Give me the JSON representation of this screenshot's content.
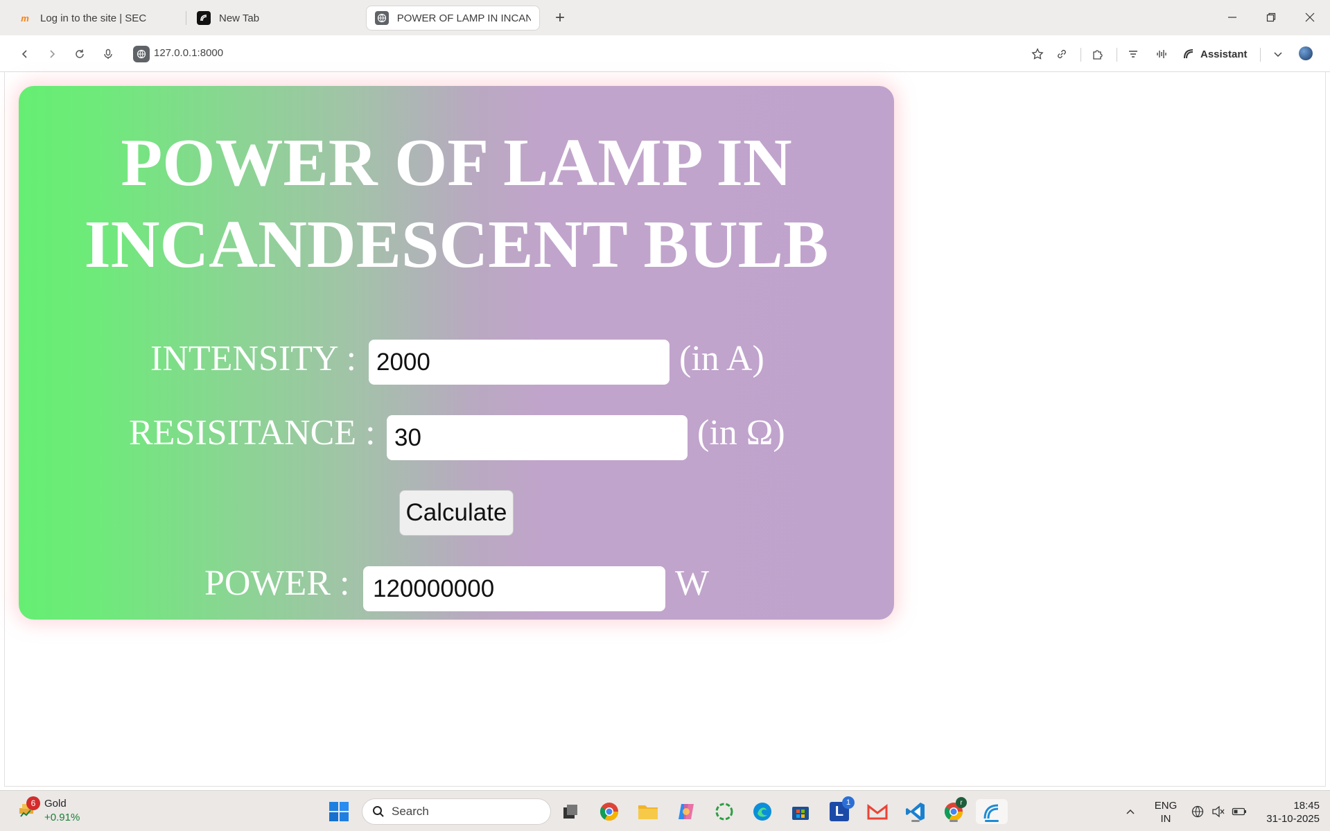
{
  "browser": {
    "tabs": [
      {
        "label": "Log in to the site | SEC",
        "icon": "moodle-icon"
      },
      {
        "label": "New Tab",
        "icon": "browser-logo-icon"
      },
      {
        "label": "POWER OF LAMP IN INCAND",
        "icon": "globe-icon",
        "active": true
      }
    ],
    "url": "127.0.0.1:8000",
    "assistant_label": "Assistant"
  },
  "page": {
    "title": "POWER OF LAMP IN INCANDESCENT BULB",
    "intensity": {
      "label": "INTENSITY :",
      "value": "2000",
      "unit": "(in A)"
    },
    "resistance": {
      "label": "RESISITANCE :",
      "value": "30",
      "unit": "(in Ω)"
    },
    "calculate_label": "Calculate",
    "power": {
      "label": "POWER :",
      "value": "120000000",
      "unit": "W"
    }
  },
  "taskbar": {
    "widget": {
      "badge": "6",
      "name": "Gold",
      "change": "+0.91%"
    },
    "search_placeholder": "Search",
    "mail_badge": "1",
    "chrome_badge": "r",
    "language": {
      "line1": "ENG",
      "line2": "IN"
    },
    "clock": {
      "time": "18:45",
      "date": "31-10-2025"
    }
  },
  "colors": {
    "card_green": "#66ee73",
    "card_purple": "#c0a3cc",
    "glow": "#ff96a0"
  }
}
